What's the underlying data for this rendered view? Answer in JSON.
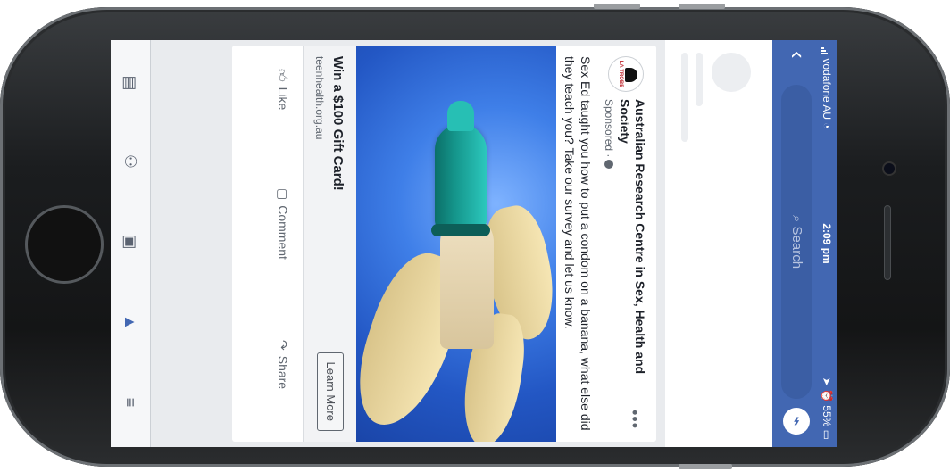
{
  "status_bar": {
    "carrier": "vodafone AU",
    "time": "2:09 pm",
    "battery": "55%"
  },
  "nav": {
    "search_placeholder": "Search"
  },
  "post": {
    "page_name": "Australian Research Centre in Sex, Health and Society",
    "sponsored_label": "Sponsored ·",
    "logo_text": "LA TROBE",
    "text": "Sex Ed taught you how to put a condom on a banana, what else did they teach you? Take our survey and let us know.",
    "ad_title": "Win a $100 Gift Card!",
    "ad_domain": "teenhealth.org.au",
    "cta_label": "Learn More",
    "actions": {
      "like": "Like",
      "comment": "Comment",
      "share": "Share"
    }
  },
  "tabbar": {
    "icons": [
      "news-feed-icon",
      "groups-icon",
      "marketplace-icon",
      "notifications-icon",
      "menu-icon"
    ],
    "active": "notifications-icon"
  },
  "colors": {
    "brand": "#4267b2",
    "accent_teal": "#15968c"
  }
}
